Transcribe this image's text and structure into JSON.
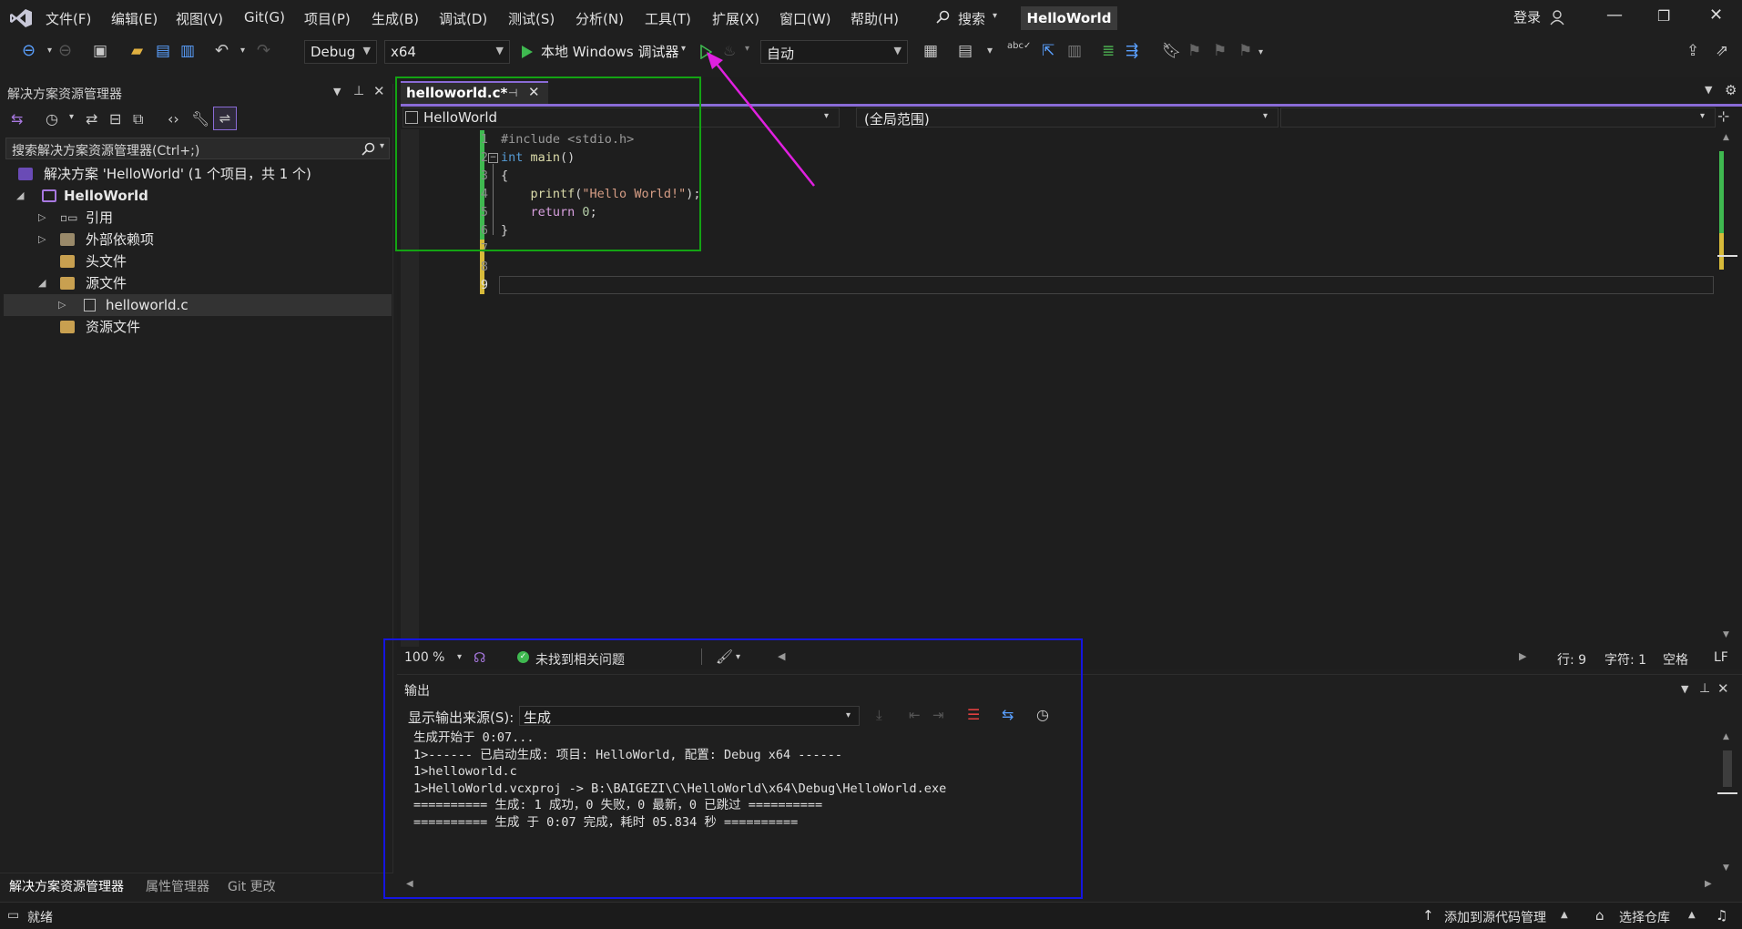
{
  "menu": [
    "文件(F)",
    "编辑(E)",
    "视图(V)",
    "Git(G)",
    "项目(P)",
    "生成(B)",
    "调试(D)",
    "测试(S)",
    "分析(N)",
    "工具(T)",
    "扩展(X)",
    "窗口(W)",
    "帮助(H)"
  ],
  "search_label": "搜索",
  "solution_title": "HelloWorld",
  "login_label": "登录",
  "toolbar": {
    "config": "Debug",
    "platform": "x64",
    "run_label": "本地 Windows 调试器",
    "auto_combo": "自动"
  },
  "solution_explorer": {
    "title": "解决方案资源管理器",
    "search_placeholder": "搜索解决方案资源管理器(Ctrl+;)",
    "root": "解决方案 'HelloWorld' (1 个项目，共 1 个)",
    "project": "HelloWorld",
    "items": [
      "引用",
      "外部依赖项",
      "头文件",
      "源文件",
      "helloworld.c",
      "资源文件"
    ]
  },
  "editor": {
    "tab": "helloworld.c*",
    "nav_left": "HelloWorld",
    "nav_mid": "(全局范围)",
    "lines": [
      "#include <stdio.h>",
      "int main()",
      "{",
      "    printf(\"Hello World!\");",
      "    return 0;",
      "}",
      "",
      "",
      ""
    ],
    "zoom": "100 %",
    "issues": "未找到相关问题",
    "row": "行: 9",
    "col": "字符: 1",
    "whitespace": "空格",
    "eol": "LF"
  },
  "output": {
    "title": "输出",
    "source_label": "显示输出来源(S):",
    "source_value": "生成",
    "lines": [
      "生成开始于 0:07...",
      "1>------ 已启动生成: 项目: HelloWorld, 配置: Debug x64 ------",
      "1>helloworld.c",
      "1>HelloWorld.vcxproj -> B:\\BAIGEZI\\C\\HelloWorld\\x64\\Debug\\HelloWorld.exe",
      "========== 生成: 1 成功，0 失败，0 最新，0 已跳过 ==========",
      "========== 生成 于 0:07 完成，耗时 05.834 秒 =========="
    ]
  },
  "bottom_tabs": [
    "解决方案资源管理器",
    "属性管理器",
    "Git 更改"
  ],
  "status": {
    "ready": "就绪",
    "add_source": "添加到源代码管理",
    "select_repo": "选择仓库"
  },
  "colors": {
    "accent": "#8a6bd6",
    "green_box": "#13a313",
    "blue_box": "#1515e0",
    "arrow": "#e020e0",
    "run_green": "#3fb950"
  }
}
